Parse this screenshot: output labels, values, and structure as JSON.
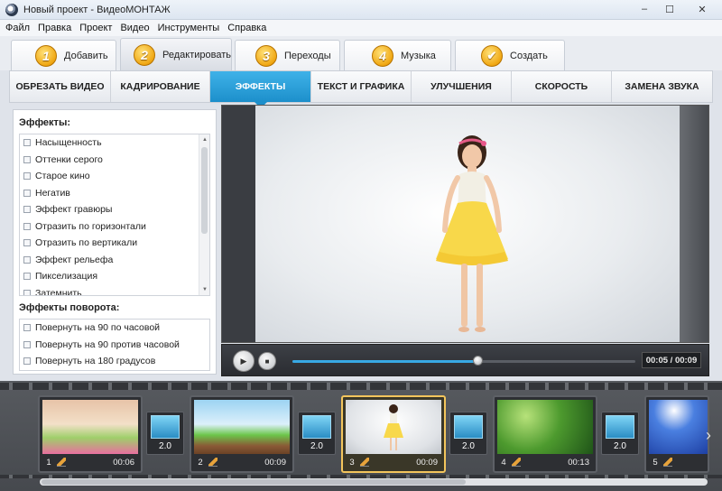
{
  "window": {
    "title": "Новый проект - ВидеоМОНТАЖ",
    "minimize": "–",
    "maximize": "☐",
    "close": "✕"
  },
  "menu": [
    "Файл",
    "Правка",
    "Проект",
    "Видео",
    "Инструменты",
    "Справка"
  ],
  "steps": [
    {
      "num": "1",
      "label": "Добавить"
    },
    {
      "num": "2",
      "label": "Редактировать"
    },
    {
      "num": "3",
      "label": "Переходы"
    },
    {
      "num": "4",
      "label": "Музыка"
    },
    {
      "num": "✔",
      "label": "Создать"
    }
  ],
  "subtabs": [
    "ОБРЕЗАТЬ ВИДЕО",
    "КАДРИРОВАНИЕ",
    "ЭФФЕКТЫ",
    "ТЕКСТ И ГРАФИКА",
    "УЛУЧШЕНИЯ",
    "СКОРОСТЬ",
    "ЗАМЕНА ЗВУКА"
  ],
  "effects": {
    "title": "Эффекты:",
    "items": [
      "Насыщенность",
      "Оттенки серого",
      "Старое кино",
      "Негатив",
      "Эффект гравюры",
      "Отразить по горизонтали",
      "Отразить по вертикали",
      "Эффект рельефа",
      "Пикселизация",
      "Затемнить"
    ]
  },
  "rotation": {
    "title": "Эффекты поворота:",
    "items": [
      "Повернуть на 90 по часовой",
      "Повернуть на 90 против часовой",
      "Повернуть на 180 градусов"
    ]
  },
  "player": {
    "time": "00:05 / 00:09",
    "progress": 0.54,
    "play_icon": "play-icon",
    "stop_icon": "stop-icon"
  },
  "clips": [
    {
      "num": "1",
      "time": "00:06",
      "thumb": "flowers"
    },
    {
      "num": "2",
      "time": "00:09",
      "thumb": "grass-sky"
    },
    {
      "num": "3",
      "time": "00:09",
      "thumb": "girl"
    },
    {
      "num": "4",
      "time": "00:13",
      "thumb": "forest"
    },
    {
      "num": "5",
      "time": "",
      "thumb": "blue-flowers"
    }
  ],
  "transitions": [
    "2.0",
    "2.0",
    "2.0",
    "2.0"
  ],
  "colors": {
    "accent": "#1c8fcb",
    "step_badge": "#f0a713",
    "selected_clip": "#f3c55c"
  }
}
